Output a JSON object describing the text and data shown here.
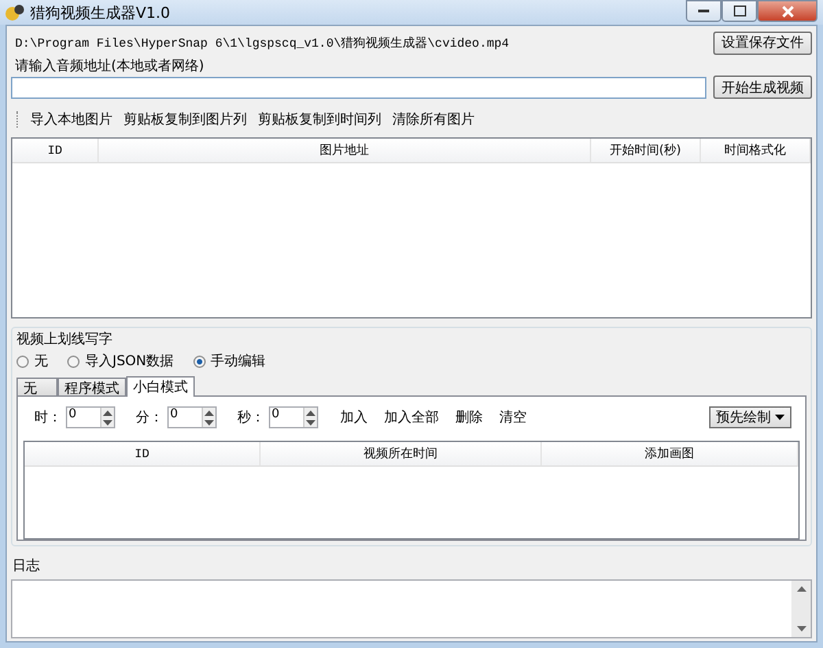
{
  "window": {
    "title": "猎狗视频生成器V1.0"
  },
  "output_path": "D:\\Program Files\\HyperSnap 6\\1\\lgspscq_v1.0\\猎狗视频生成器\\cvideo.mp4",
  "save_button": "设置保存文件",
  "audio": {
    "label": "请输入音频地址(本地或者网络)",
    "button": "开始生成视频"
  },
  "toolbar": [
    "导入本地图片",
    "剪贴板复制到图片列",
    "剪贴板复制到时间列",
    "清除所有图片"
  ],
  "image_table": {
    "columns": [
      "ID",
      "图片地址",
      "开始时间(秒)",
      "时间格式化"
    ]
  },
  "draw_group": {
    "title": "视频上划线写字",
    "radios": [
      {
        "label": "无",
        "selected": false
      },
      {
        "label": "导入JSON数据",
        "selected": false
      },
      {
        "label": "手动编辑",
        "selected": true
      }
    ],
    "tabs": [
      {
        "label": "无",
        "selected": false
      },
      {
        "label": "程序模式",
        "selected": false
      },
      {
        "label": "小白模式",
        "selected": true
      }
    ],
    "spinners": [
      {
        "label": "时：",
        "value": "0"
      },
      {
        "label": "分：",
        "value": "0"
      },
      {
        "label": "秒：",
        "value": "0"
      }
    ],
    "actions": [
      "加入",
      "加入全部",
      "删除",
      "清空"
    ],
    "dropdown": "预先绘制",
    "table": {
      "columns": [
        "ID",
        "视频所在时间",
        "添加画图"
      ]
    }
  },
  "log": {
    "label": "日志"
  }
}
